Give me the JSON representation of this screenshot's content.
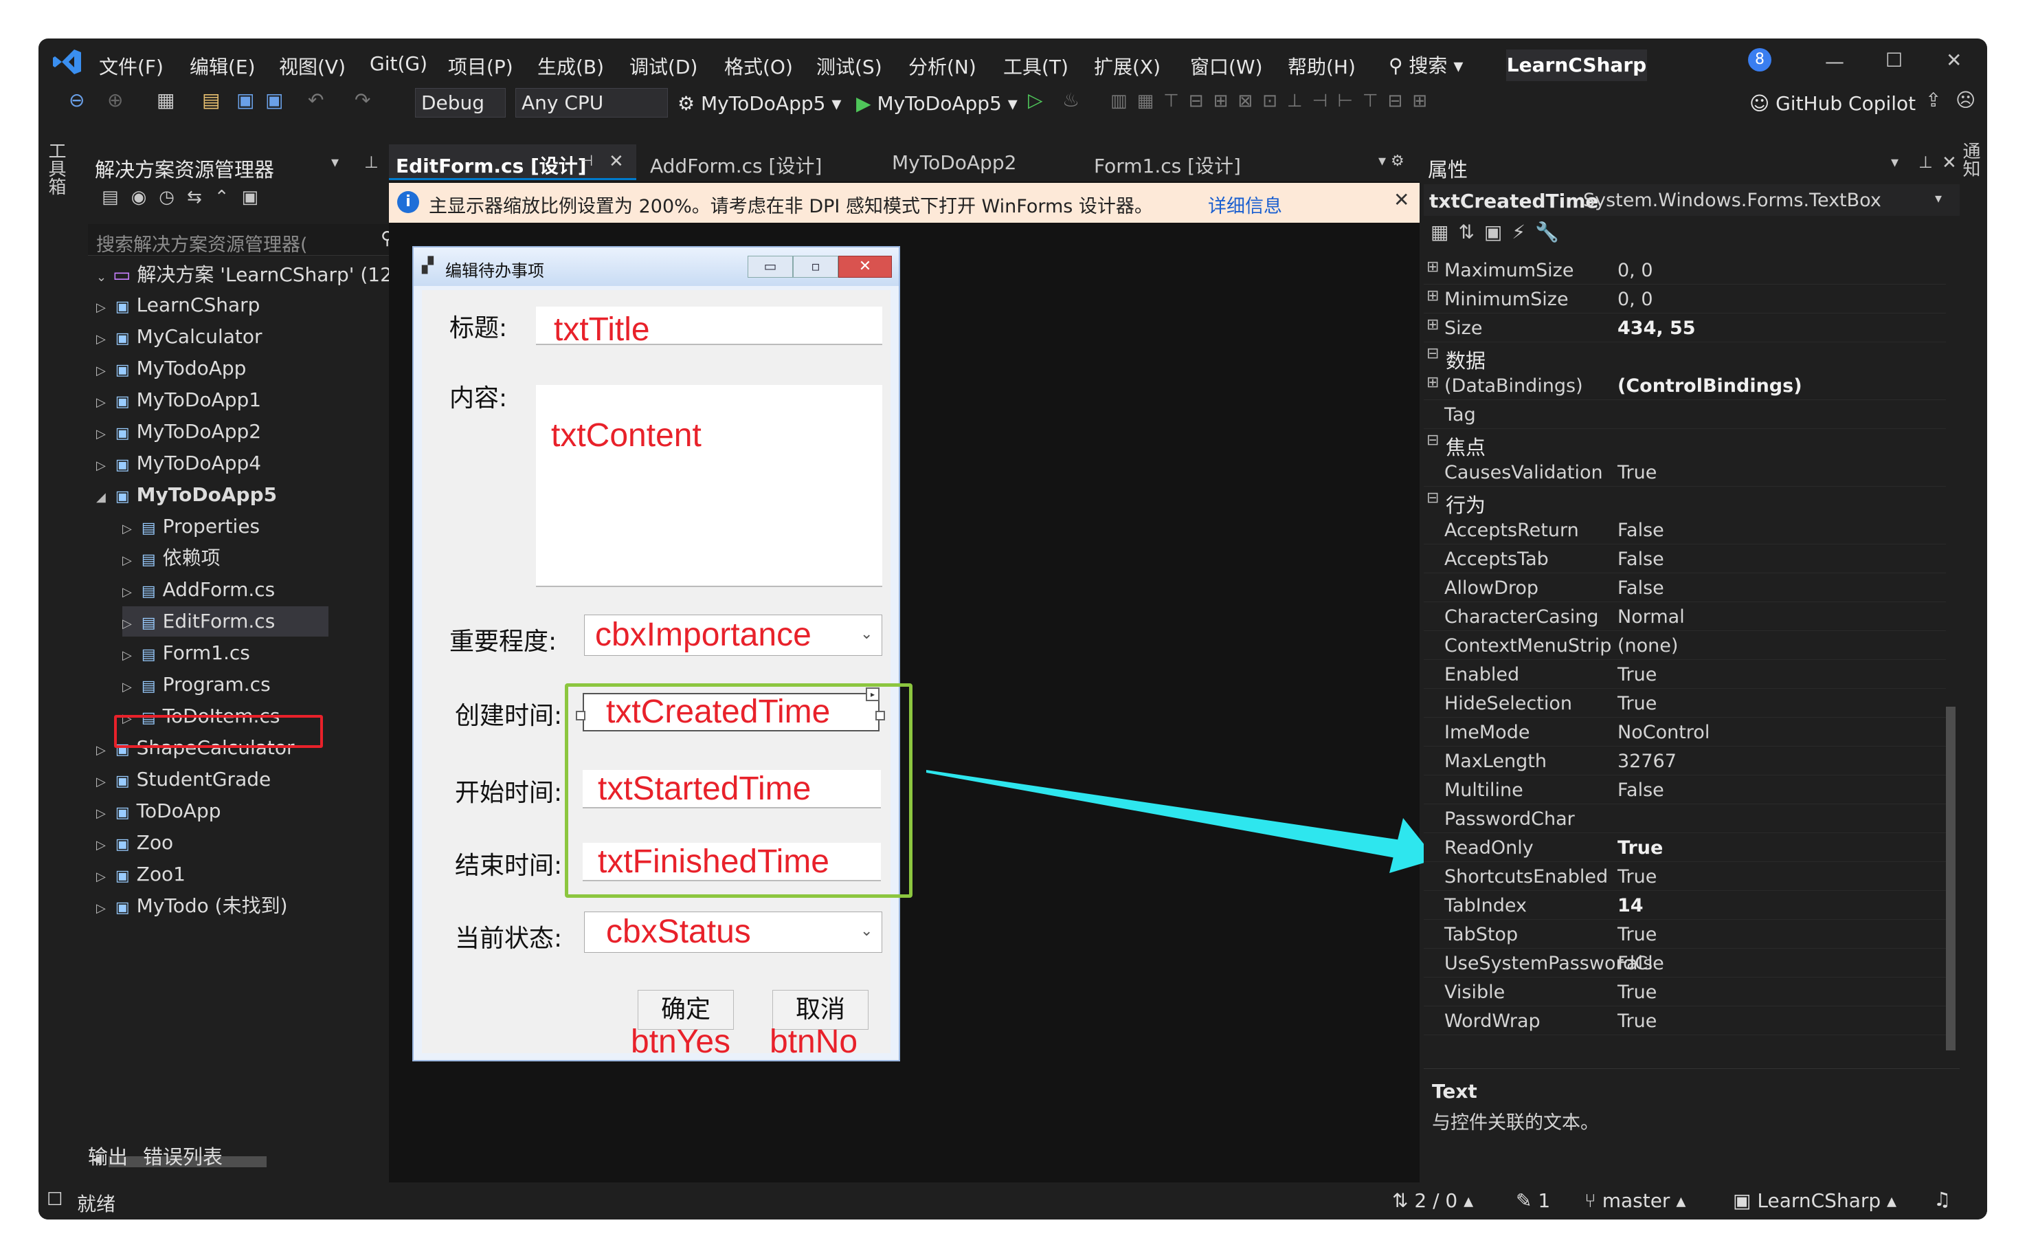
{
  "menu": [
    "文件(F)",
    "编辑(E)",
    "视图(V)",
    "Git(G)",
    "项目(P)",
    "生成(B)",
    "调试(D)",
    "格式(O)",
    "测试(S)",
    "分析(N)",
    "工具(T)",
    "扩展(X)",
    "窗口(W)",
    "帮助(H)"
  ],
  "search_label": "搜索",
  "solution_title": "LearnCSharp",
  "notification_count": "8",
  "toolbar": {
    "config": "Debug",
    "platform": "Any CPU",
    "startup": "MyToDoApp5",
    "run_target": "MyToDoApp5",
    "copilot": "GitHub Copilot"
  },
  "side_toolbox": "工具箱",
  "side_right": "通知",
  "solution_explorer": {
    "title": "解决方案资源管理器",
    "search_placeholder": "搜索解决方案资源管理器(",
    "root": "解决方案 'LearnCSharp' (12",
    "items": [
      {
        "label": "LearnCSharp"
      },
      {
        "label": "MyCalculator"
      },
      {
        "label": "MyTodoApp"
      },
      {
        "label": "MyToDoApp1"
      },
      {
        "label": "MyToDoApp2"
      },
      {
        "label": "MyToDoApp4"
      },
      {
        "label": "MyToDoApp5"
      },
      {
        "label": "Properties"
      },
      {
        "label": "依赖项"
      },
      {
        "label": "AddForm.cs"
      },
      {
        "label": "EditForm.cs"
      },
      {
        "label": "Form1.cs"
      },
      {
        "label": "Program.cs"
      },
      {
        "label": "ToDoItem.cs"
      },
      {
        "label": "ShapeCalculator"
      },
      {
        "label": "StudentGrade"
      },
      {
        "label": "ToDoApp"
      },
      {
        "label": "Zoo"
      },
      {
        "label": "Zoo1"
      },
      {
        "label": "MyTodo (未找到)"
      }
    ]
  },
  "tabs": [
    {
      "label": "EditForm.cs [设计]"
    },
    {
      "label": "AddForm.cs [设计]"
    },
    {
      "label": "MyToDoApp2"
    },
    {
      "label": "Form1.cs [设计]"
    }
  ],
  "info_bar": {
    "text": "主显示器缩放比例设置为 200%。请考虑在非 DPI 感知模式下打开 WinForms 设计器。",
    "link": "详细信息"
  },
  "form": {
    "title": "编辑待办事项",
    "labels": {
      "title": "标题:",
      "content": "内容:",
      "importance": "重要程度:",
      "created": "创建时间:",
      "started": "开始时间:",
      "finished": "结束时间:",
      "status": "当前状态:"
    },
    "controls": {
      "title": "txtTitle",
      "content": "txtContent",
      "importance": "cbxImportance",
      "created": "txtCreatedTime",
      "started": "txtStartedTime",
      "finished": "txtFinishedTime",
      "status": "cbxStatus",
      "yes_name": "btnYes",
      "no_name": "btnNo"
    },
    "buttons": {
      "ok": "确定",
      "cancel": "取消"
    }
  },
  "properties": {
    "title": "属性",
    "object": "txtCreatedTime",
    "object_type": "System.Windows.Forms.TextBox",
    "rows": [
      {
        "type": "prop",
        "name": "MaximumSize",
        "value": "0, 0",
        "expand": true
      },
      {
        "type": "prop",
        "name": "MinimumSize",
        "value": "0, 0",
        "expand": true
      },
      {
        "type": "prop",
        "name": "Size",
        "value": "434, 55",
        "expand": true,
        "bold": true
      },
      {
        "type": "cat",
        "name": "数据"
      },
      {
        "type": "prop",
        "name": "(DataBindings)",
        "value": "(ControlBindings)",
        "expand": true,
        "bold": true
      },
      {
        "type": "prop",
        "name": "Tag",
        "value": ""
      },
      {
        "type": "cat",
        "name": "焦点"
      },
      {
        "type": "prop",
        "name": "CausesValidation",
        "value": "True"
      },
      {
        "type": "cat",
        "name": "行为"
      },
      {
        "type": "prop",
        "name": "AcceptsReturn",
        "value": "False"
      },
      {
        "type": "prop",
        "name": "AcceptsTab",
        "value": "False"
      },
      {
        "type": "prop",
        "name": "AllowDrop",
        "value": "False"
      },
      {
        "type": "prop",
        "name": "CharacterCasing",
        "value": "Normal"
      },
      {
        "type": "prop",
        "name": "ContextMenuStrip",
        "value": "(none)"
      },
      {
        "type": "prop",
        "name": "Enabled",
        "value": "True"
      },
      {
        "type": "prop",
        "name": "HideSelection",
        "value": "True"
      },
      {
        "type": "prop",
        "name": "ImeMode",
        "value": "NoControl"
      },
      {
        "type": "prop",
        "name": "MaxLength",
        "value": "32767"
      },
      {
        "type": "prop",
        "name": "Multiline",
        "value": "False"
      },
      {
        "type": "prop",
        "name": "PasswordChar",
        "value": ""
      },
      {
        "type": "prop",
        "name": "ReadOnly",
        "value": "True",
        "bold": true
      },
      {
        "type": "prop",
        "name": "ShortcutsEnabled",
        "value": "True"
      },
      {
        "type": "prop",
        "name": "TabIndex",
        "value": "14",
        "bold": true
      },
      {
        "type": "prop",
        "name": "TabStop",
        "value": "True"
      },
      {
        "type": "prop",
        "name": "UseSystemPasswordCl",
        "value": "False"
      },
      {
        "type": "prop",
        "name": "Visible",
        "value": "True"
      },
      {
        "type": "prop",
        "name": "WordWrap",
        "value": "True"
      }
    ],
    "desc_title": "Text",
    "desc_text": "与控件关联的文本。"
  },
  "bottom_tabs": {
    "output": "输出",
    "errors": "错误列表"
  },
  "status": {
    "ready": "就绪",
    "changes": "2 / 0",
    "pencil": "1",
    "branch": "master",
    "repo": "LearnCSharp"
  },
  "colors": {
    "accent": "#007acc",
    "highlight_red": "#e8212a",
    "highlight_green": "#8cc63f",
    "arrow": "#2ee6ee"
  }
}
